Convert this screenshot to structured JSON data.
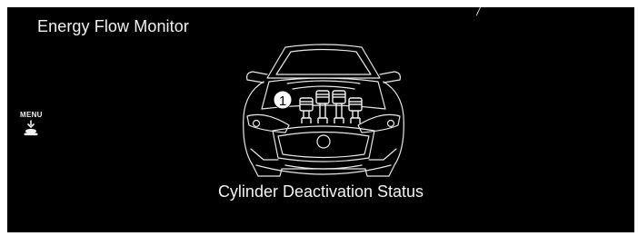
{
  "screen": {
    "title": "Energy Flow Monitor",
    "caption": "Cylinder Deactivation Status"
  },
  "menu_button": {
    "label": "MENU",
    "icon": "menu-press-icon"
  },
  "illustration": {
    "icon": "car-front-icon",
    "cylinders": 4,
    "callout": "1"
  },
  "colors": {
    "background": "#000000",
    "foreground": "#f2f2f2"
  }
}
